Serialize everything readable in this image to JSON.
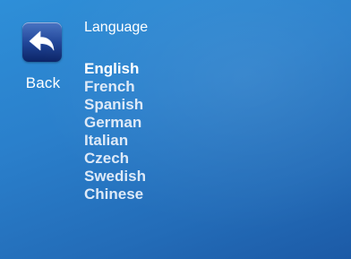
{
  "back_button": {
    "label": "Back",
    "icon": "back-arrow-icon"
  },
  "title": "Language",
  "languages": [
    {
      "label": "English",
      "selected": true
    },
    {
      "label": "French",
      "selected": false
    },
    {
      "label": "Spanish",
      "selected": false
    },
    {
      "label": "German",
      "selected": false
    },
    {
      "label": "Italian",
      "selected": false
    },
    {
      "label": "Czech",
      "selected": false
    },
    {
      "label": "Swedish",
      "selected": false
    },
    {
      "label": "Chinese",
      "selected": false
    }
  ],
  "colors": {
    "background": "#2a7fcb",
    "text": "#ffffff",
    "icon_box": "#22479a"
  }
}
